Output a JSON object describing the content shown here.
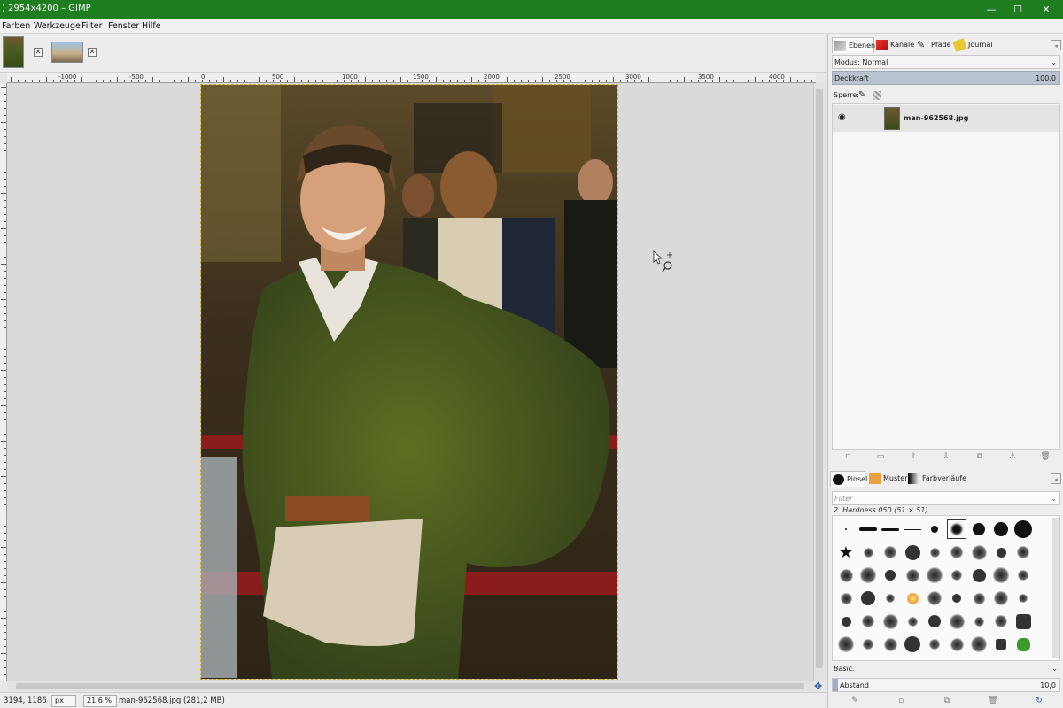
{
  "window": {
    "title": ") 2954x4200 – GIMP",
    "minimize": "—",
    "maximize": "☐",
    "close": "✕"
  },
  "menu": [
    "Farben",
    "Werkzeuge",
    "Filter",
    "Fenster",
    "Hilfe"
  ],
  "image_tabs": [
    {
      "name": "portrait-thumbnail",
      "close": "✕"
    },
    {
      "name": "building-thumbnail",
      "close": "✕"
    }
  ],
  "ruler": {
    "labels": [
      "-1000",
      "-500",
      "0",
      "500",
      "1000",
      "1500",
      "2000",
      "2500",
      "3000",
      "3500",
      "4000"
    ]
  },
  "status": {
    "coords": "3194, 1186",
    "unit": "px",
    "zoom": "21,6 %",
    "file": "man-962568.jpg (281,2 MB)"
  },
  "layers_panel": {
    "tabs": [
      "Ebenen",
      "Kanäle",
      "Pfade",
      "Journal"
    ],
    "mode_label": "Modus: Normal",
    "opacity_label": "Deckkraft",
    "opacity_value": "100,0",
    "lock_label": "Sperre:",
    "layer_name": "man-962568.jpg"
  },
  "brushes_panel": {
    "tabs": [
      "Pinsel",
      "Muster",
      "Farbverläufe"
    ],
    "filter_placeholder": "Filter",
    "current_brush": "2. Hardness 050 (51 × 51)",
    "preset": "Basic.",
    "spacing_label": "Abstand",
    "spacing_value": "10,0"
  },
  "colors": {
    "titlebar": "#1e7d1e",
    "canvas": "#dadada",
    "dock": "#eeeeee"
  }
}
